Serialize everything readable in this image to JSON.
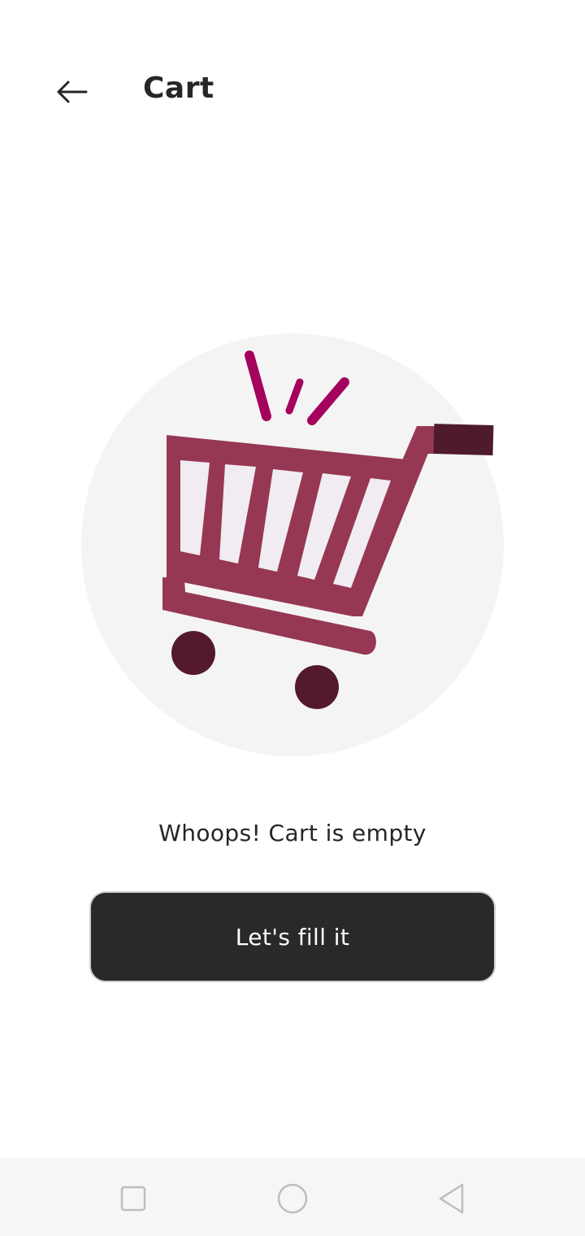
{
  "header": {
    "title": "Cart",
    "back_icon": "arrow-left-icon"
  },
  "illustration": {
    "icon": "shopping-cart-icon",
    "colors": {
      "circle": "#f4f4f4",
      "cart_body": "#963853",
      "cart_slots": "#f0ecf2",
      "handle": "#4f1a2c",
      "wheels": "#53192e",
      "sparks": "#a4035d"
    }
  },
  "empty_state": {
    "message": "Whoops! Cart is empty",
    "button_label": "Let's fill it"
  },
  "nav_bar": {
    "recents_icon": "square-icon",
    "home_icon": "circle-icon",
    "back_icon": "triangle-back-icon"
  }
}
